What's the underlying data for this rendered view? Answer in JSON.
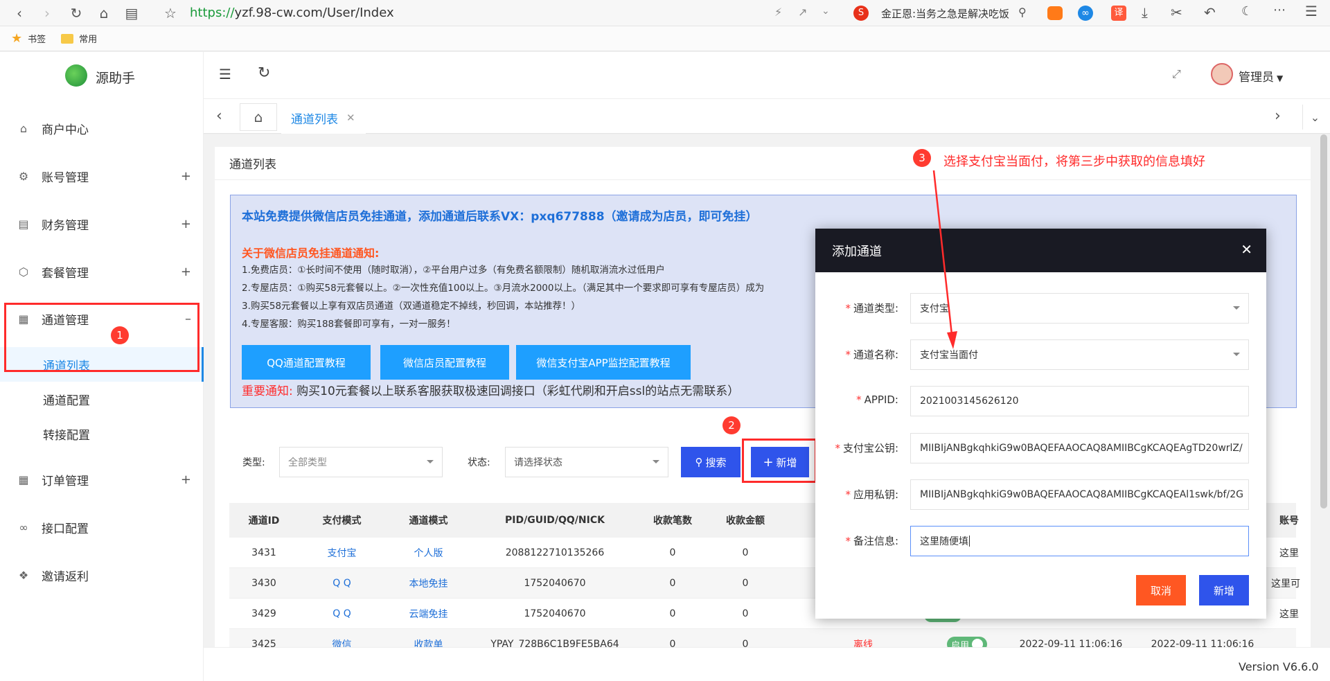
{
  "browser": {
    "url_scheme": "https://",
    "url_rest": "yzf.98-cw.com/User/Index",
    "search_text": "金正恩:当务之急是解决吃饭"
  },
  "bookmarks": {
    "item1": "书签",
    "item2": "常用"
  },
  "app": {
    "name": "源助手",
    "user": "管理员",
    "version": "Version V6.6.0"
  },
  "sidebar": {
    "items": [
      {
        "label": "商户中心"
      },
      {
        "label": "账号管理"
      },
      {
        "label": "财务管理"
      },
      {
        "label": "套餐管理"
      },
      {
        "label": "通道管理"
      },
      {
        "label": "订单管理"
      },
      {
        "label": "接口配置"
      },
      {
        "label": "邀请返利"
      }
    ],
    "sub": [
      "通道列表",
      "通道配置",
      "转接配置"
    ]
  },
  "tab": {
    "label": "通道列表"
  },
  "page": {
    "title": "通道列表"
  },
  "notice": {
    "headline": "本站免费提供微信店员免挂通道，添加通道后联系VX：pxq677888（邀请成为店员，即可免挂）",
    "subhead": "关于微信店员免挂通道通知:",
    "lines": [
      "1.免费店员：①长时间不使用（随时取消），②平台用户过多（有免费名额限制）随机取消流水过低用户",
      "2.专屋店员：①购买58元套餐以上。②一次性充值100以上。③月流水2000以上。（满足其中一个要求即可享有专屋店员）成为",
      "3.购买58元套餐以上享有双店员通道（双通道稳定不掉线，秒回调，本站推荐！）",
      "4.专屋客服：购买188套餐即可享有，一对一服务！"
    ],
    "buttons": [
      "QQ通道配置教程",
      "微信店员配置教程",
      "微信支付宝APP监控配置教程"
    ],
    "important_label": "重要通知:",
    "important_text": "购买10元套餐以上联系客服获取极速回调接口（彩虹代刷和开启ssl的站点无需联系）"
  },
  "filters": {
    "type_label": "类型:",
    "type_value": "全部类型",
    "status_label": "状态:",
    "status_value": "请选择状态",
    "search_btn": "搜索",
    "add_btn": "新增"
  },
  "table": {
    "headers": [
      "通道ID",
      "支付模式",
      "通道模式",
      "PID/GUID/QQ/NICK",
      "收款笔数",
      "收款金额",
      "账号"
    ],
    "rows": [
      {
        "id": "3431",
        "pay": "支付宝",
        "mode": "个人版",
        "pid": "2088122710135266",
        "count": "0",
        "amount": "0",
        "tail": "这里"
      },
      {
        "id": "3430",
        "pay": "Q Q",
        "mode": "本地免挂",
        "pid": "1752040670",
        "count": "0",
        "amount": "0",
        "tail": "这里可"
      },
      {
        "id": "3429",
        "pay": "Q Q",
        "mode": "云端免挂",
        "pid": "1752040670",
        "count": "0",
        "amount": "0",
        "tail": "这里"
      },
      {
        "id": "3425",
        "pay": "微信",
        "mode": "收款单",
        "pid": "YPAY_728B6C1B9FE5BA64",
        "count": "0",
        "amount": "0",
        "status": "离线",
        "enabled": "启用",
        "t1": "2022-09-11 11:06:16",
        "t2": "2022-09-11 11:06:16"
      }
    ]
  },
  "dialog": {
    "title": "添加通道",
    "fields": [
      {
        "label": "通道类型:",
        "value": "支付宝"
      },
      {
        "label": "通道名称:",
        "value": "支付宝当面付"
      },
      {
        "label": "APPID:",
        "value": "2021003145626120"
      },
      {
        "label": "支付宝公钥:",
        "value": "MIIBIjANBgkqhkiG9w0BAQEFAAOCAQ8AMIIBCgKCAQEAgTD20wrlZ/"
      },
      {
        "label": "应用私钥:",
        "value": "MIIBIjANBgkqhkiG9w0BAQEFAAOCAQ8AMIIBCgKCAQEAl1swk/bf/2G"
      },
      {
        "label": "备注信息:",
        "value": "这里随便填"
      }
    ],
    "cancel": "取消",
    "submit": "新增"
  },
  "annotations": {
    "b1": "1",
    "b2": "2",
    "b3": "3",
    "note3": "选择支付宝当面付，将第三步中获取的信息填好"
  },
  "colors": {
    "accent": "#1e9fff",
    "primary_btn": "#2f54eb",
    "danger": "#ff5722",
    "annotation": "#ff2b2b"
  }
}
